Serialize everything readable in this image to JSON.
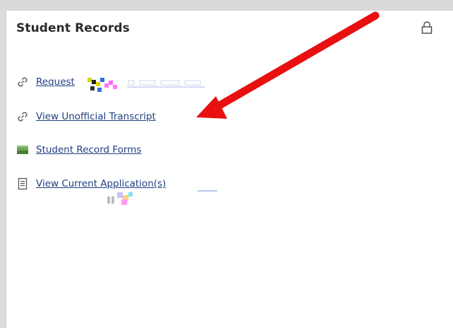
{
  "card": {
    "title": "Student Records"
  },
  "links": [
    {
      "label": "Request",
      "icon": "link-icon"
    },
    {
      "label": "View Unofficial Transcript",
      "icon": "link-icon"
    },
    {
      "label": "Student Record Forms",
      "icon": "form-image-icon"
    },
    {
      "label": "View Current Application(s)",
      "icon": "document-icon"
    }
  ],
  "colors": {
    "link": "#1f3f82",
    "annotation_arrow": "#e81010",
    "title": "#2b2b2b"
  }
}
